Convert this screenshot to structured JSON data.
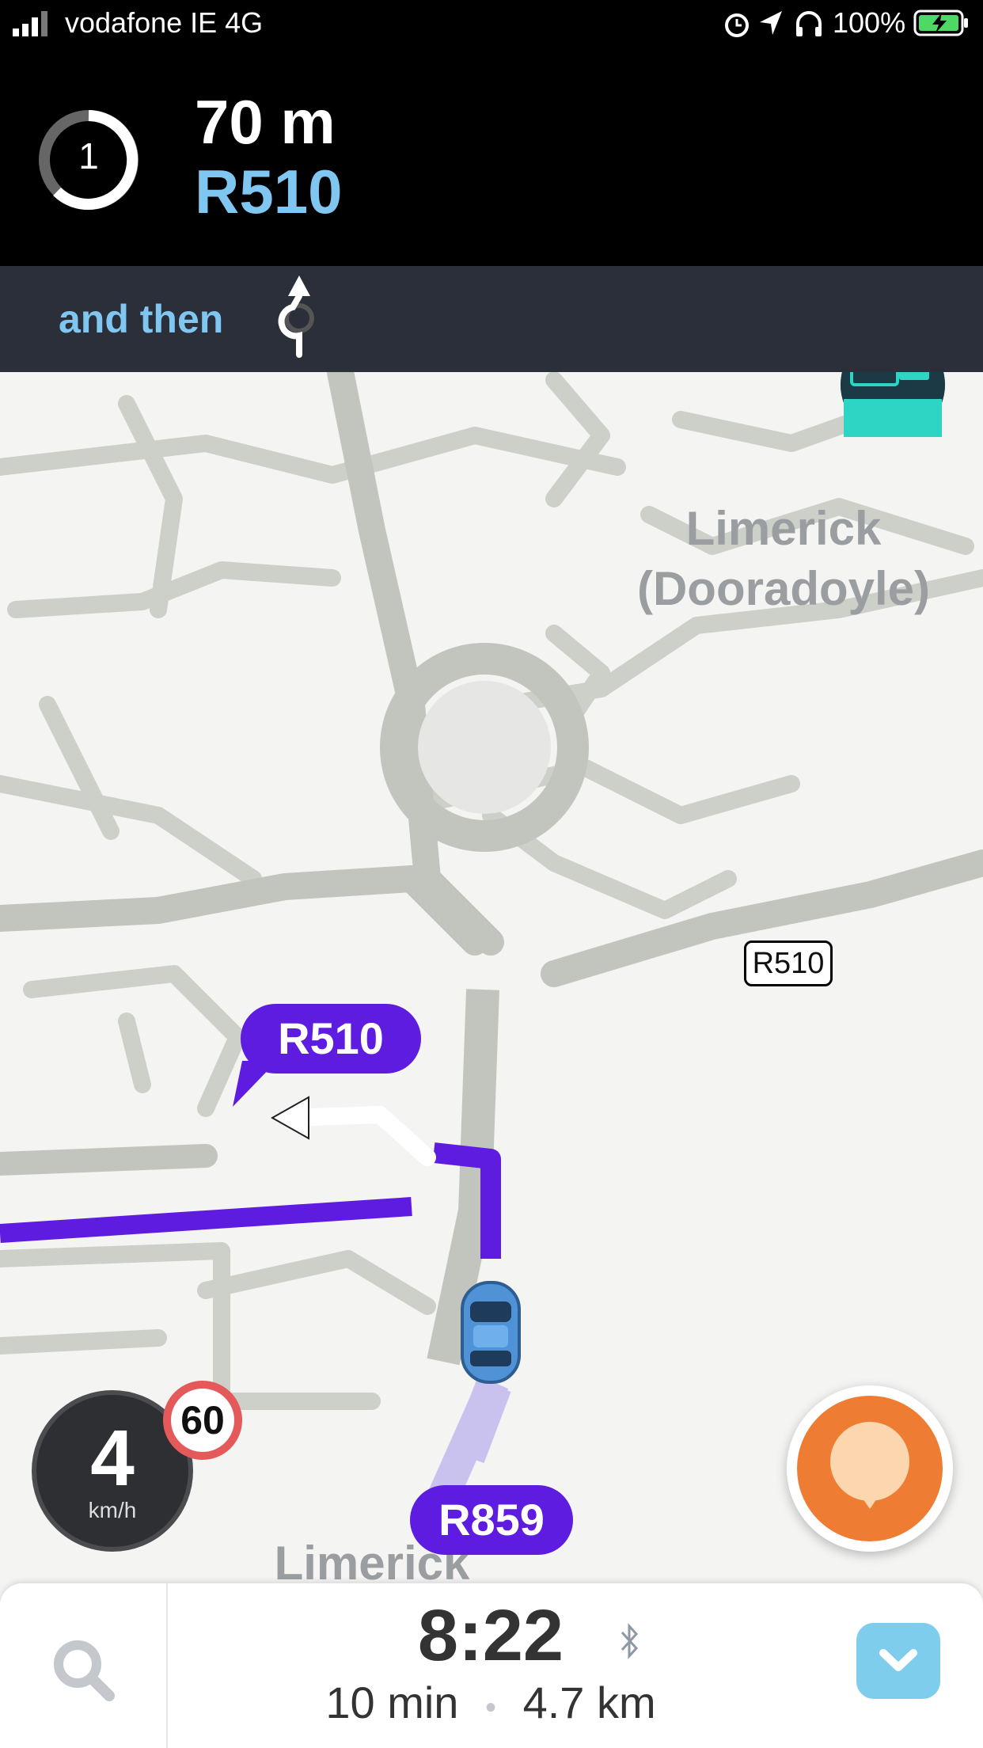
{
  "status_bar": {
    "carrier": "vodafone IE 4G",
    "battery": "100%"
  },
  "instruction": {
    "exit_number": "1",
    "distance": "70 m",
    "road": "R510"
  },
  "then": {
    "label": "and then"
  },
  "map": {
    "area_label": "Limerick (Dooradoyle)",
    "area_label_bottom": "Limerick",
    "road_sign": "R510",
    "route_label_ahead": "R510",
    "route_label_current": "R859"
  },
  "speed": {
    "value": "4",
    "unit": "km/h",
    "limit": "60"
  },
  "bottom": {
    "eta": "8:22",
    "duration": "10 min",
    "separator": "•",
    "distance": "4.7 km"
  },
  "colors": {
    "route": "#5e1ce0",
    "accent": "#7fc6f0",
    "report": "#ee7d33"
  }
}
